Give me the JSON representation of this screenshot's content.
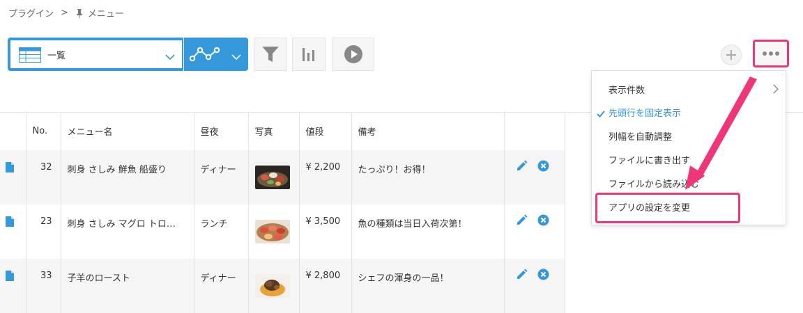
{
  "breadcrumb": {
    "parent": "プラグイン",
    "separator": ">",
    "current": "メニュー"
  },
  "toolbar": {
    "view_label": "一覧",
    "icons": [
      "table-icon",
      "chevron-down-icon",
      "graph-icon",
      "chevron-down-icon",
      "filter-icon",
      "bar-chart-icon",
      "play-icon",
      "plus-icon",
      "more-icon"
    ]
  },
  "table": {
    "headers": [
      "No.",
      "メニュー名",
      "昼夜",
      "写真",
      "値段",
      "備考"
    ],
    "rows": [
      {
        "no": "32",
        "name": "刺身 さしみ 鮮魚 船盛り",
        "time": "ディナー",
        "price": "¥ 2,200",
        "note": "たっぷり！お得！"
      },
      {
        "no": "23",
        "name": "刺身 さしみ マグロ トロ…",
        "time": "ランチ",
        "price": "¥ 3,500",
        "note": "魚の種類は当日入荷次第！"
      },
      {
        "no": "33",
        "name": "子羊のロースト",
        "time": "ディナー",
        "price": "¥ 2,800",
        "note": "シェフの渾身の一品！"
      }
    ]
  },
  "menu": {
    "items": [
      {
        "label": "表示件数",
        "has_submenu": true
      },
      {
        "label": "先頭行を固定表示",
        "checked": true
      },
      {
        "label": "列幅を自動調整"
      },
      {
        "label": "ファイルに書き出す"
      },
      {
        "label": "ファイルから読み込む"
      },
      {
        "label": "アプリの設定を変更",
        "highlighted": true
      }
    ]
  },
  "colors": {
    "accent": "#3498db",
    "highlight": "#f0367a",
    "row_stripe": "#f5f5f5"
  }
}
